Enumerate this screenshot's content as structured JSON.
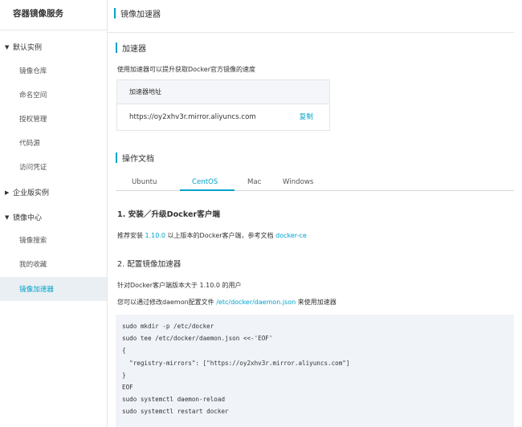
{
  "sidebar": {
    "title": "容器镜像服务",
    "groups": [
      {
        "label": "默认实例",
        "expanded": true,
        "items": [
          "镜像仓库",
          "命名空间",
          "授权管理",
          "代码源",
          "访问凭证"
        ]
      },
      {
        "label": "企业版实例",
        "expanded": false,
        "items": []
      },
      {
        "label": "镜像中心",
        "expanded": true,
        "items": [
          "镜像搜索",
          "我的收藏",
          "镜像加速器"
        ]
      }
    ],
    "active_item": "镜像加速器"
  },
  "header": {
    "title": "镜像加速器"
  },
  "accelerator": {
    "section_title": "加速器",
    "description": "使用加速器可以提升获取Docker官方镜像的速度",
    "table_header": "加速器地址",
    "address": "https://oy2xhv3r.mirror.aliyuncs.com",
    "copy_label": "复制"
  },
  "docs": {
    "section_title": "操作文档",
    "tabs": [
      "Ubuntu",
      "CentOS",
      "Mac",
      "Windows"
    ],
    "active_tab": "CentOS",
    "step1": {
      "title": "1. 安装／升级Docker客户端",
      "text_prefix": "推荐安装",
      "version": "1.10.0",
      "text_mid": "以上版本的Docker客户端，参考文档",
      "link": "docker-ce"
    },
    "step2": {
      "title": "2. 配置镜像加速器",
      "line1": "针对Docker客户端版本大于 1.10.0 的用户",
      "line2_prefix": "您可以通过修改daemon配置文件",
      "line2_path": "/etc/docker/daemon.json",
      "line2_suffix": "来使用加速器"
    },
    "code_lines": [
      "sudo mkdir -p /etc/docker",
      "sudo tee /etc/docker/daemon.json <<-'EOF'",
      "{",
      "  \"registry-mirrors\": [\"https://oy2xhv3r.mirror.aliyuncs.com\"]",
      "}",
      "EOF",
      "sudo systemctl daemon-reload",
      "sudo systemctl restart docker"
    ]
  },
  "colors": {
    "accent": "#00a2ca",
    "active_bg": "#eaeff4",
    "code_bg": "#f0f3f8"
  }
}
